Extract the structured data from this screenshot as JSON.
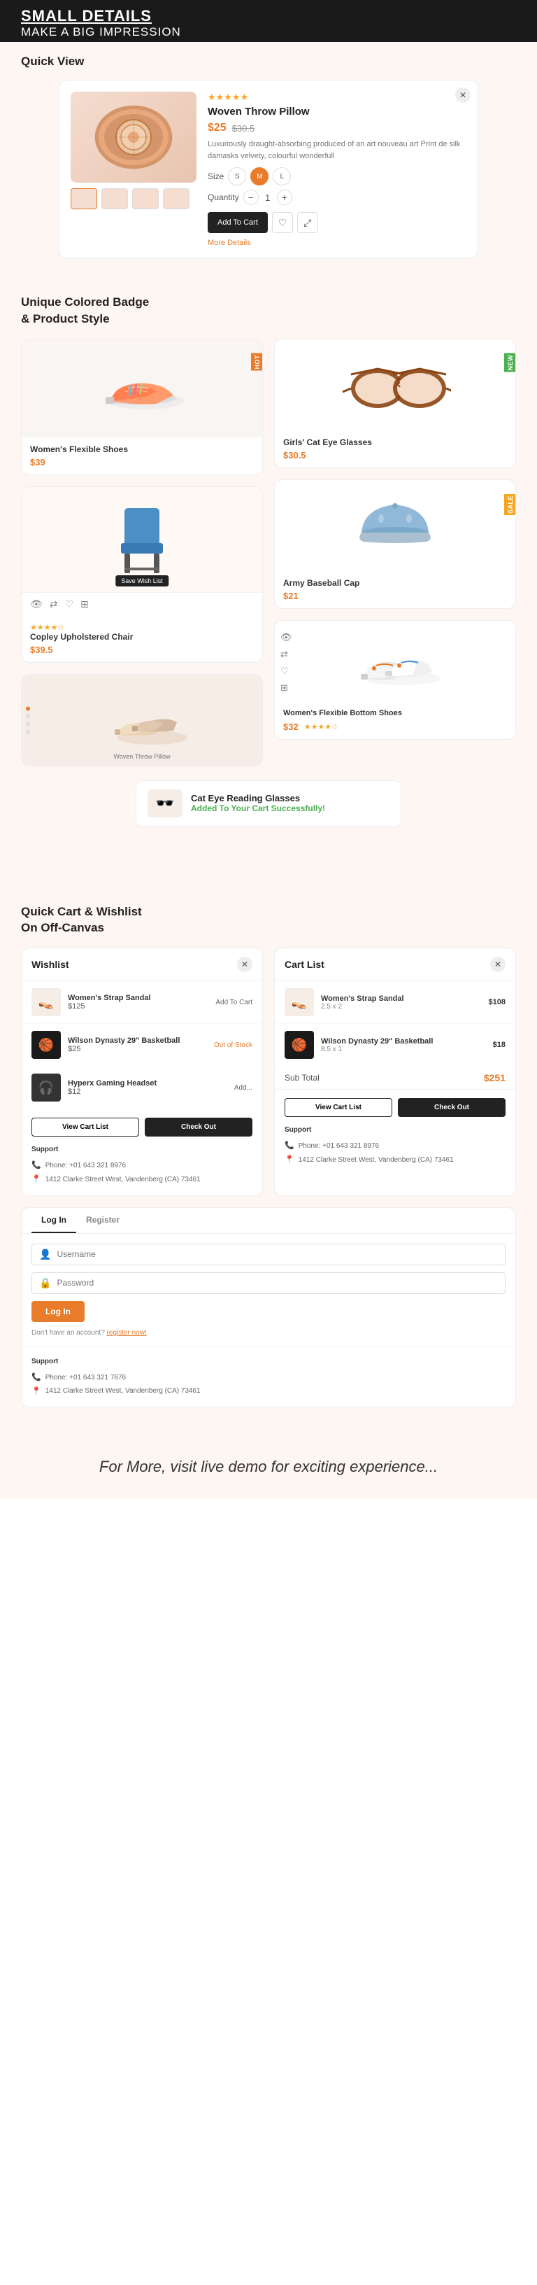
{
  "header": {
    "line1": "SMALL DETAILS",
    "line2": "MAKE A BIG IMPRESSION"
  },
  "quickView": {
    "label": "Quick View",
    "product": {
      "title": "Woven Throw Pillow",
      "price": "$25",
      "oldPrice": "$30.5",
      "stars": "★★★★★",
      "description": "Luxuriously draught-absorbing produced of an art nouveau art Print de silk damasks velvety, colourful wonderfull",
      "sizeLabel": "Size",
      "sizes": [
        "S",
        "M",
        "L"
      ],
      "quantityLabel": "Quantity",
      "addToCartBtn": "Add To Cart",
      "moreDetails": "More Details"
    }
  },
  "badgeSection": {
    "label1": "Unique Colored Badge",
    "label2": "& Product Style",
    "products": [
      {
        "name": "Women's Flexible Shoes",
        "price": "$39",
        "badge": "HOT",
        "badgeColor": "orange"
      },
      {
        "name": "Girls' Cat Eye Glasses",
        "price": "$30.5",
        "badge": "NEW",
        "badgeColor": "green"
      },
      {
        "name": "Copley Upholstered Chair",
        "price": "$39.5",
        "badge": "",
        "rating": "★★★★☆"
      },
      {
        "name": "Army Baseball Cap",
        "price": "$21",
        "badge": "SALE",
        "badgeColor": "yellow"
      },
      {
        "name": "Woven Throw Pillow",
        "price": "",
        "badge": ""
      },
      {
        "name": "Women's Flexible Bottom Shoes",
        "price": "$32",
        "rating": "★★★★☆"
      }
    ]
  },
  "cartToast": {
    "productName": "Cat Eye Reading Glasses",
    "message": "Added To Your Cart Successfully!"
  },
  "offcanvas": {
    "label1": "Quick Cart & Wishlist",
    "label2": "On Off-Canvas",
    "wishlist": {
      "title": "Wishlist",
      "items": [
        {
          "name": "Women's Strap Sandal",
          "price": "$125",
          "action": "Add To Cart"
        },
        {
          "name": "Wilson Dynasty 29\" Basketball",
          "price": "$25",
          "action": "Out of Stock",
          "outOfStock": true
        },
        {
          "name": "Hyperx Gaming Headset",
          "price": "$12",
          "action": "Add..."
        }
      ],
      "viewCartBtn": "View Cart List",
      "checkOutBtn": "Check Out",
      "support": {
        "title": "Support",
        "phone": "Phone: +01 643 321 8976",
        "address": "1412 Clarke Street West, Vandenberg (CA) 73461"
      }
    },
    "cart": {
      "title": "Cart List",
      "items": [
        {
          "name": "Women's Strap Sandal",
          "qty": "2.5 x 2",
          "price": "$108"
        },
        {
          "name": "Wilson Dynasty 29\" Basketball",
          "qty": "8.5 x 1",
          "price": "$18"
        }
      ],
      "subtotalLabel": "Sub Total",
      "subtotalValue": "$251",
      "viewCartBtn": "View Cart List",
      "checkOutBtn": "Check Out",
      "support": {
        "title": "Support",
        "phone": "Phone: +01 643 321 8976",
        "address": "1412 Clarke Street West, Vandenberg (CA) 73461"
      }
    },
    "account": {
      "tabs": [
        "Log In",
        "Register"
      ],
      "activeTab": "Log In",
      "usernamePlaceholder": "Username",
      "passwordPlaceholder": "Password",
      "loginBtn": "Log In",
      "registerNote": "Don't have an account?",
      "registerLink": "register now!",
      "support": {
        "title": "Support",
        "phone": "Phone: +01 643 321 7676",
        "address": "1412 Clarke Street West, Vandenberg (CA) 73461"
      }
    }
  },
  "footer": {
    "text": "For More, visit live demo for exciting experience..."
  }
}
